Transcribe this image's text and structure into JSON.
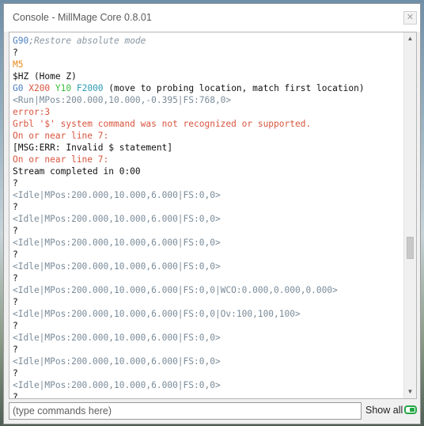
{
  "window": {
    "title": "Console - MillMage Core 0.8.01",
    "close_glyph": "✕"
  },
  "colors": {
    "blue": "#4a7fc1",
    "orange": "#e8891c",
    "red": "#d9553f",
    "gray": "#7a8b99",
    "default": "#111111",
    "green": "#3bbf3b",
    "teal": "#2c9bb5",
    "comment": "#8a97a3"
  },
  "log_lines": [
    [
      {
        "t": "G90",
        "c": "blue"
      },
      {
        "t": ";Restore absolute mode",
        "c": "comment",
        "i": true
      }
    ],
    [
      {
        "t": "?",
        "c": "default"
      }
    ],
    [
      {
        "t": "M5",
        "c": "orange"
      }
    ],
    [
      {
        "t": "$HZ (Home Z)",
        "c": "default"
      }
    ],
    [
      {
        "t": "G0 ",
        "c": "blue"
      },
      {
        "t": "X200 ",
        "c": "red"
      },
      {
        "t": "Y10 ",
        "c": "green"
      },
      {
        "t": "F2000",
        "c": "teal"
      },
      {
        "t": " (move to probing location, match first location)",
        "c": "default"
      }
    ],
    [
      {
        "t": "<Run|MPos:200.000,10.000,-0.395|FS:768,0>",
        "c": "gray"
      }
    ],
    [
      {
        "t": "error:3",
        "c": "red"
      }
    ],
    [
      {
        "t": "Grbl '$' system command was not recognized or supported.",
        "c": "red"
      }
    ],
    [
      {
        "t": "On or near line 7:",
        "c": "red"
      }
    ],
    [
      {
        "t": "[MSG:ERR: Invalid $ statement]",
        "c": "default"
      }
    ],
    [
      {
        "t": "On or near line 7:",
        "c": "red"
      }
    ],
    [
      {
        "t": "Stream completed in 0:00",
        "c": "default"
      }
    ],
    [
      {
        "t": "?",
        "c": "default"
      }
    ],
    [
      {
        "t": "<Idle|MPos:200.000,10.000,6.000|FS:0,0>",
        "c": "gray"
      }
    ],
    [
      {
        "t": "?",
        "c": "default"
      }
    ],
    [
      {
        "t": "<Idle|MPos:200.000,10.000,6.000|FS:0,0>",
        "c": "gray"
      }
    ],
    [
      {
        "t": "?",
        "c": "default"
      }
    ],
    [
      {
        "t": "<Idle|MPos:200.000,10.000,6.000|FS:0,0>",
        "c": "gray"
      }
    ],
    [
      {
        "t": "?",
        "c": "default"
      }
    ],
    [
      {
        "t": "<Idle|MPos:200.000,10.000,6.000|FS:0,0>",
        "c": "gray"
      }
    ],
    [
      {
        "t": "?",
        "c": "default"
      }
    ],
    [
      {
        "t": "<Idle|MPos:200.000,10.000,6.000|FS:0,0|WCO:0.000,0.000,0.000>",
        "c": "gray"
      }
    ],
    [
      {
        "t": "?",
        "c": "default"
      }
    ],
    [
      {
        "t": "<Idle|MPos:200.000,10.000,6.000|FS:0,0|Ov:100,100,100>",
        "c": "gray"
      }
    ],
    [
      {
        "t": "?",
        "c": "default"
      }
    ],
    [
      {
        "t": "<Idle|MPos:200.000,10.000,6.000|FS:0,0>",
        "c": "gray"
      }
    ],
    [
      {
        "t": "?",
        "c": "default"
      }
    ],
    [
      {
        "t": "<Idle|MPos:200.000,10.000,6.000|FS:0,0>",
        "c": "gray"
      }
    ],
    [
      {
        "t": "?",
        "c": "default"
      }
    ],
    [
      {
        "t": "<Idle|MPos:200.000,10.000,6.000|FS:0,0>",
        "c": "gray"
      }
    ],
    [
      {
        "t": "?",
        "c": "default"
      }
    ]
  ],
  "input": {
    "placeholder": "(type commands here)",
    "value": ""
  },
  "show_all": {
    "label": "Show all",
    "enabled": true
  },
  "scrollbar": {
    "up_glyph": "▲",
    "down_glyph": "▼"
  }
}
